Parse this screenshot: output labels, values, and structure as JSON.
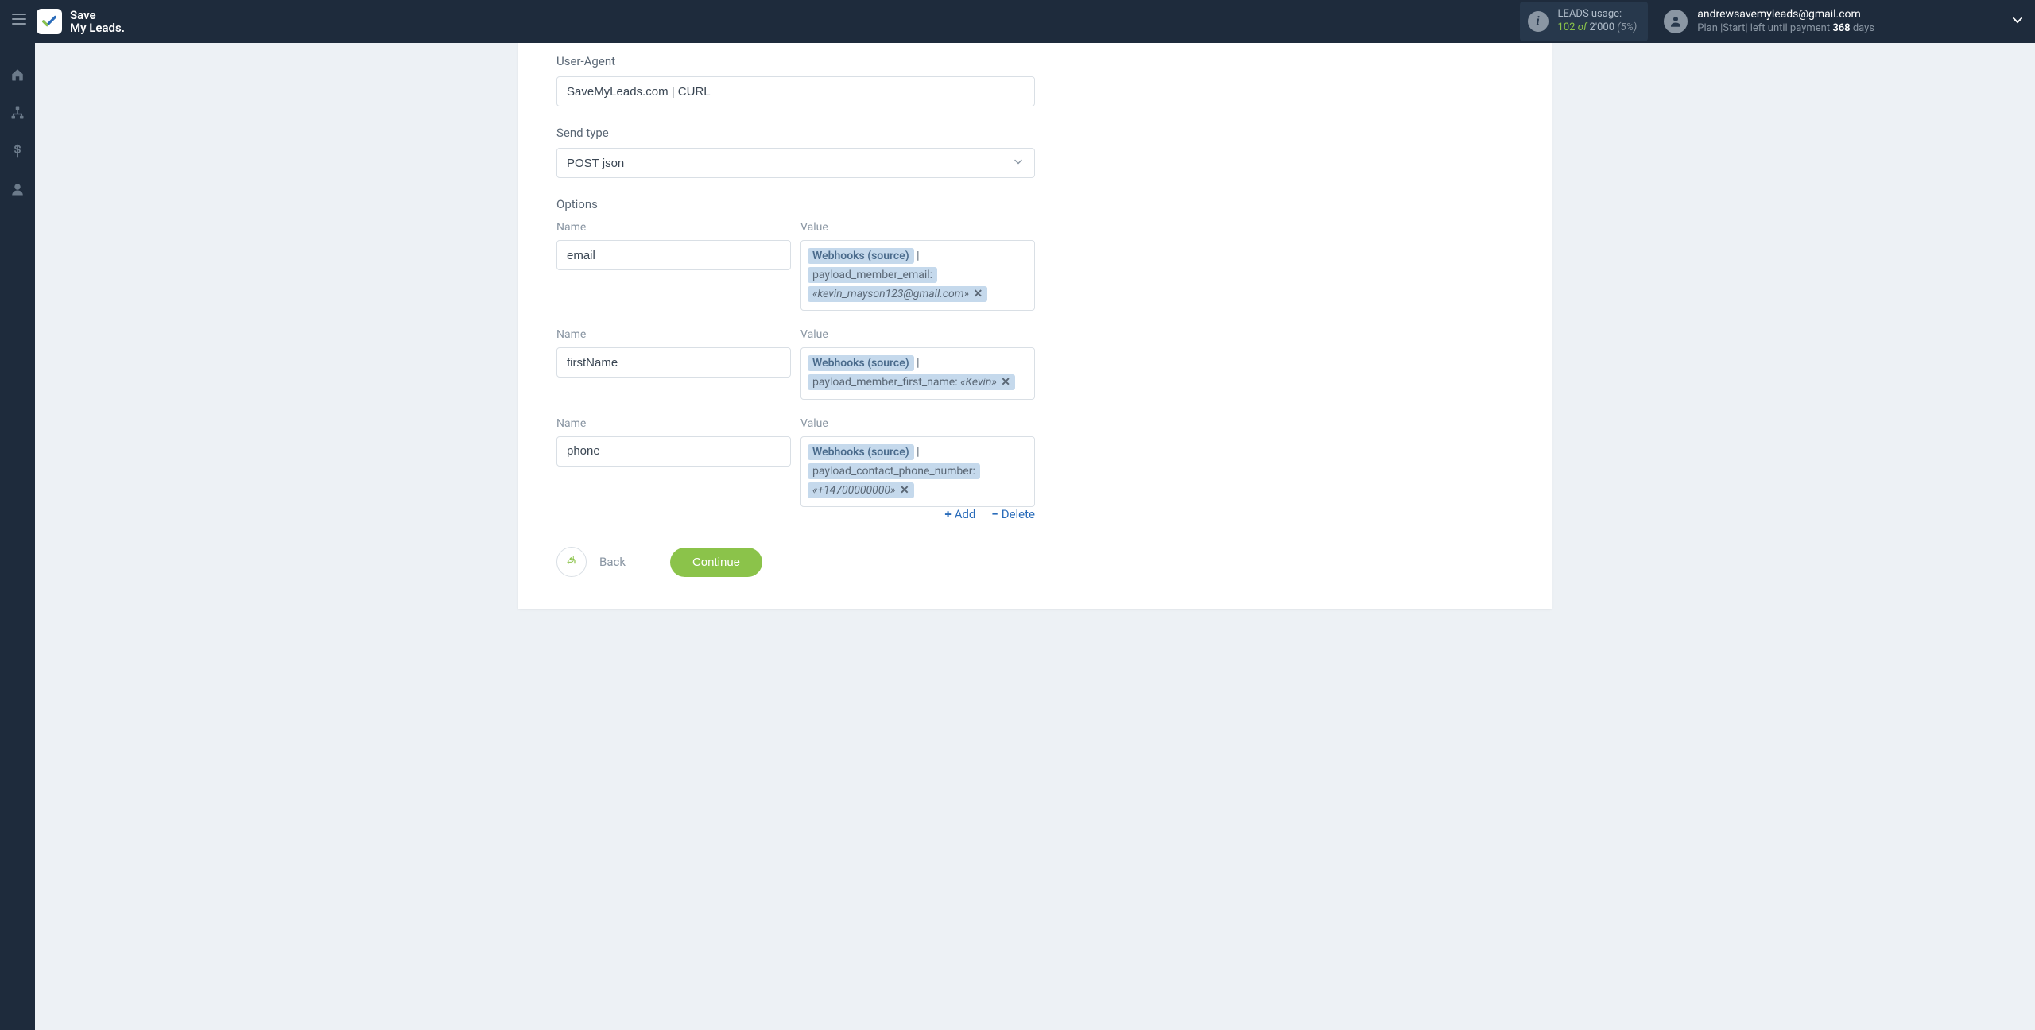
{
  "header": {
    "logo": {
      "line1": "Save",
      "line2": "My Leads."
    },
    "leads_usage": {
      "label": "LEADS usage:",
      "count": "102",
      "of": "of",
      "max": "2'000",
      "pct": "(5%)"
    },
    "user": {
      "email": "andrewsavemyleads@gmail.com",
      "plan_prefix": "Plan |",
      "plan_name": "Start",
      "plan_mid": "| left until payment ",
      "days": "368",
      "plan_suffix": " days"
    }
  },
  "form": {
    "user_agent_label": "User-Agent",
    "user_agent_value": "SaveMyLeads.com | CURL",
    "send_type_label": "Send type",
    "send_type_value": "POST json",
    "options_label": "Options",
    "name_col": "Name",
    "value_col": "Value",
    "rows": [
      {
        "name": "email",
        "source": "Webhooks (source)",
        "path": "payload_member_email:",
        "value": "«kevin_mayson123@gmail.com»"
      },
      {
        "name": "firstName",
        "source": "Webhooks (source)",
        "path": "payload_member_first_name: ",
        "value": "«Kevin»"
      },
      {
        "name": "phone",
        "source": "Webhooks (source)",
        "path": "payload_contact_phone_number:",
        "value": "«+14700000000»"
      }
    ],
    "add_label": "Add",
    "delete_label": "Delete",
    "back_label": "Back",
    "continue_label": "Continue"
  }
}
